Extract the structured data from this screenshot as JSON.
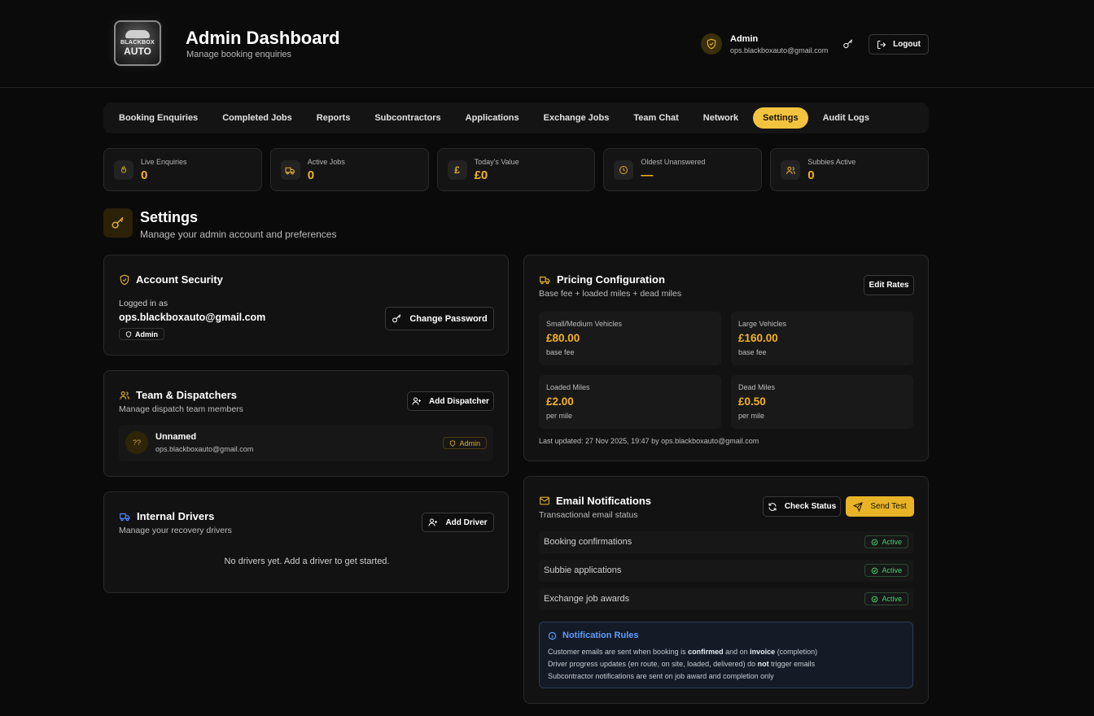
{
  "header": {
    "logo_line1": "BLACKBOX",
    "logo_line2": "AUTO",
    "title": "Admin Dashboard",
    "subtitle": "Manage booking enquiries",
    "user_name": "Admin",
    "user_email": "ops.blackboxauto@gmail.com",
    "logout_label": "Logout"
  },
  "tabs": [
    {
      "label": "Booking Enquiries",
      "active": false
    },
    {
      "label": "Completed Jobs",
      "active": false
    },
    {
      "label": "Reports",
      "active": false
    },
    {
      "label": "Subcontractors",
      "active": false
    },
    {
      "label": "Applications",
      "active": false
    },
    {
      "label": "Exchange Jobs",
      "active": false
    },
    {
      "label": "Team Chat",
      "active": false
    },
    {
      "label": "Network",
      "active": false
    },
    {
      "label": "Settings",
      "active": true
    },
    {
      "label": "Audit Logs",
      "active": false
    }
  ],
  "stats": [
    {
      "label": "Live Enquiries",
      "value": "0",
      "icon": "flame-icon"
    },
    {
      "label": "Active Jobs",
      "value": "0",
      "icon": "truck-icon"
    },
    {
      "label": "Today's Value",
      "value": "£0",
      "icon": "pound-icon"
    },
    {
      "label": "Oldest Unanswered",
      "value": "—",
      "icon": "clock-icon"
    },
    {
      "label": "Subbies Active",
      "value": "0",
      "icon": "users-icon"
    }
  ],
  "settings": {
    "title": "Settings",
    "subtitle": "Manage your admin account and preferences"
  },
  "account": {
    "title": "Account Security",
    "logged_in_label": "Logged in as",
    "email": "ops.blackboxauto@gmail.com",
    "role": "Admin",
    "change_password_label": "Change Password"
  },
  "team": {
    "title": "Team & Dispatchers",
    "subtitle": "Manage dispatch team members",
    "add_label": "Add Dispatcher",
    "members": [
      {
        "initials": "??",
        "name": "Unnamed",
        "email": "ops.blackboxauto@gmail.com",
        "role": "Admin"
      }
    ]
  },
  "drivers": {
    "title": "Internal Drivers",
    "subtitle": "Manage your recovery drivers",
    "add_label": "Add Driver",
    "empty": "No drivers yet. Add a driver to get started."
  },
  "pricing": {
    "title": "Pricing Configuration",
    "subtitle": "Base fee + loaded miles + dead miles",
    "edit_label": "Edit Rates",
    "items": [
      {
        "label": "Small/Medium Vehicles",
        "value": "£80.00",
        "unit": "base fee"
      },
      {
        "label": "Large Vehicles",
        "value": "£160.00",
        "unit": "base fee"
      },
      {
        "label": "Loaded Miles",
        "value": "£2.00",
        "unit": "per mile"
      },
      {
        "label": "Dead Miles",
        "value": "£0.50",
        "unit": "per mile"
      }
    ],
    "updated": "Last updated: 27 Nov 2025, 19:47 by ops.blackboxauto@gmail.com"
  },
  "email": {
    "title": "Email Notifications",
    "subtitle": "Transactional email status",
    "check_label": "Check Status",
    "send_label": "Send Test",
    "rows": [
      {
        "label": "Booking confirmations",
        "status": "Active"
      },
      {
        "label": "Subbie applications",
        "status": "Active"
      },
      {
        "label": "Exchange job awards",
        "status": "Active"
      }
    ],
    "rules_title": "Notification Rules",
    "rule1_a": "Customer emails are sent when booking is ",
    "rule1_b": "confirmed",
    "rule1_c": " and on ",
    "rule1_d": "invoice",
    "rule1_e": " (completion)",
    "rule2_a": "Driver progress updates (en route, on site, loaded, delivered) do ",
    "rule2_b": "not",
    "rule2_c": " trigger emails",
    "rule3": "Subcontractor notifications are sent on job award and completion only"
  },
  "colors": {
    "accent": "#f3c33f",
    "value": "#f3b21f",
    "success": "#3fd16a",
    "info": "#5e9bff",
    "background": "#0a0a0a"
  }
}
